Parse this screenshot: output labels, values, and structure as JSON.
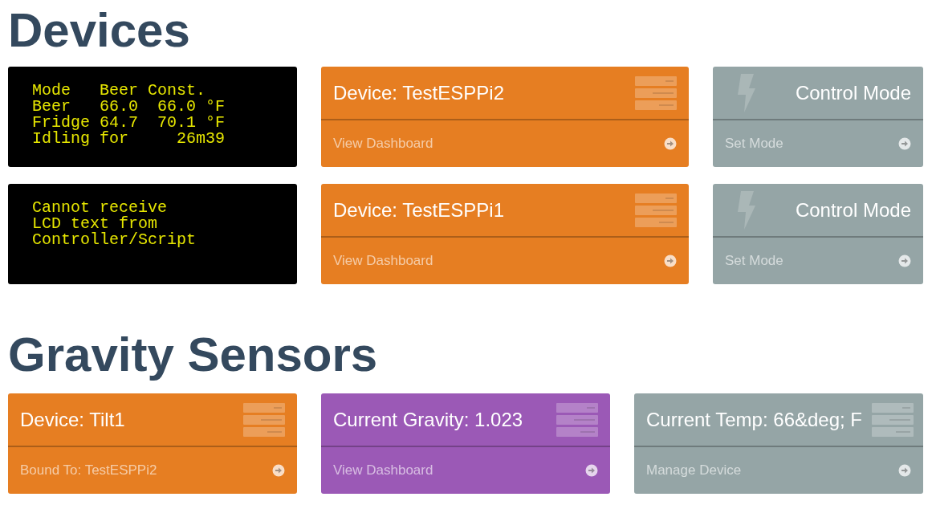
{
  "devices_heading": "Devices",
  "devices": [
    {
      "lcd": [
        "Mode   Beer Const.",
        "Beer   66.0  66.0 °F",
        "Fridge 64.7  70.1 °F",
        "Idling for     26m39"
      ],
      "device_card": {
        "kind": "server",
        "color": "#e67e22",
        "title": "Device: TestESPPi2",
        "link": "View Dashboard"
      },
      "control_card": {
        "kind": "bolt",
        "color": "#95a5a6",
        "title": "Control Mode",
        "link": "Set Mode"
      }
    },
    {
      "lcd": [
        "Cannot receive",
        "LCD text from",
        "Controller/Script"
      ],
      "device_card": {
        "kind": "server",
        "color": "#e67e22",
        "title": "Device: TestESPPi1",
        "link": "View Dashboard"
      },
      "control_card": {
        "kind": "bolt",
        "color": "#95a5a6",
        "title": "Control Mode",
        "link": "Set Mode"
      }
    }
  ],
  "gravity_heading": "Gravity Sensors",
  "gravity_cards": [
    {
      "kind": "server",
      "color": "#e67e22",
      "title": "Device: Tilt1",
      "link": "Bound To: TestESPPi2"
    },
    {
      "kind": "server",
      "color": "#9b59b6",
      "title": "Current Gravity: 1.023",
      "link": "View Dashboard"
    },
    {
      "kind": "server",
      "color": "#95a5a6",
      "title": "Current Temp: 66&deg; F",
      "link": "Manage Device"
    }
  ]
}
